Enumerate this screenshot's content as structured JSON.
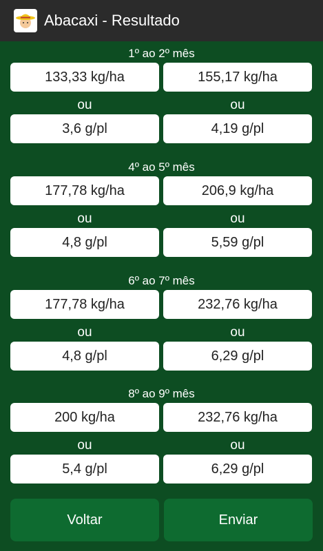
{
  "appbar": {
    "title": "Abacaxi - Resultado",
    "icon": "farmer-hat-icon"
  },
  "colors": {
    "appbar": "#2b2b2b",
    "background": "#0d4d22",
    "button": "#0e6b30"
  },
  "sections": [
    {
      "title": "1º ao 2º mês",
      "kg_left": "133,33 kg/ha",
      "kg_right": "155,17 kg/ha",
      "or_left": "ou",
      "or_right": "ou",
      "g_left": "3,6 g/pl",
      "g_right": "4,19 g/pl"
    },
    {
      "title": "4º ao 5º mês",
      "kg_left": "177,78 kg/ha",
      "kg_right": "206,9 kg/ha",
      "or_left": "ou",
      "or_right": "ou",
      "g_left": "4,8 g/pl",
      "g_right": "5,59 g/pl"
    },
    {
      "title": "6º ao 7º mês",
      "kg_left": "177,78 kg/ha",
      "kg_right": "232,76 kg/ha",
      "or_left": "ou",
      "or_right": "ou",
      "g_left": "4,8 g/pl",
      "g_right": "6,29 g/pl"
    },
    {
      "title": "8º ao 9º mês",
      "kg_left": "200 kg/ha",
      "kg_right": "232,76 kg/ha",
      "or_left": "ou",
      "or_right": "ou",
      "g_left": "5,4 g/pl",
      "g_right": "6,29 g/pl"
    }
  ],
  "buttons": {
    "back": "Voltar",
    "send": "Enviar"
  }
}
